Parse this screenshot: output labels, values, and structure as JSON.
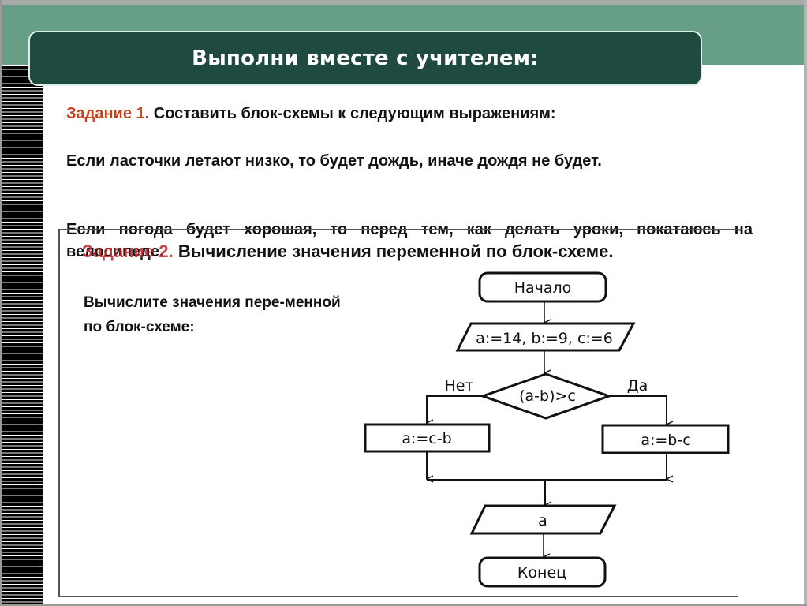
{
  "slide": {
    "title": "Выполни вместе с учителем:",
    "task1": {
      "label": "Задание 1.",
      "text": " Составить блок-схемы к следующим выражениям:",
      "expression1": "Если ласточки летают низко, то будет дождь, иначе дождя не будет.",
      "expression2": "Если погода будет хорошая, то перед тем, как делать уроки, покатаюсь на велосипеде."
    },
    "task2": {
      "label": "Задание 2.",
      "text": " Вычисление значения переменной по блок-схеме.",
      "prompt": "Вычислите значения пере-менной по блок-схеме:"
    },
    "flowchart": {
      "start": "Начало",
      "input": "a:=14, b:=9, c:=6",
      "condition": "(a-b)>c",
      "no_label": "Нет",
      "yes_label": "Да",
      "no_action": "a:=c-b",
      "yes_action": "a:=b-c",
      "output": "a",
      "end": "Конец"
    }
  }
}
